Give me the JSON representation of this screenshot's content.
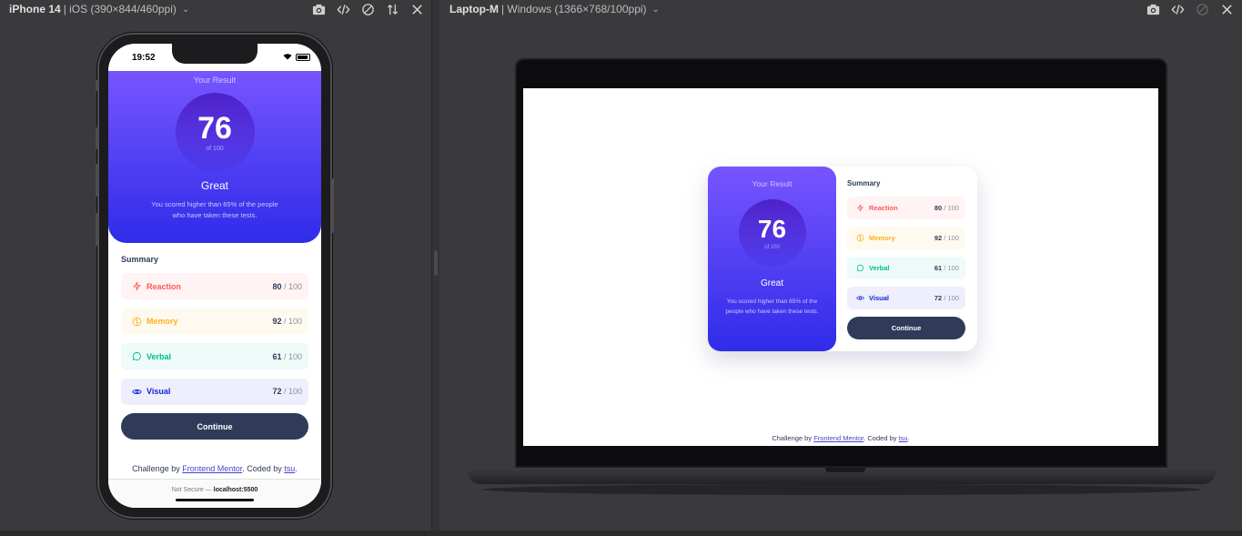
{
  "left_panel": {
    "device_name": "iPhone 14",
    "device_meta": "| iOS (390×844/460ppi)",
    "toolbar_icons": [
      "camera-icon",
      "code-icon",
      "rotate-icon",
      "swap-icon",
      "close-icon"
    ]
  },
  "right_panel": {
    "device_name": "Laptop-M",
    "device_meta": "| Windows (1366×768/100ppi)",
    "toolbar_icons": [
      "camera-icon",
      "code-icon",
      "rotate-icon",
      "close-icon"
    ]
  },
  "phone_status": {
    "time": "19:52"
  },
  "app": {
    "result_label": "Your Result",
    "score": "76",
    "score_of": "of 100",
    "verdict": "Great",
    "description": "You scored higher than 65% of the people who have taken these tests.",
    "summary_title": "Summary",
    "summary": [
      {
        "label": "Reaction",
        "score": "80",
        "total": "/ 100",
        "icon": "lightning-icon"
      },
      {
        "label": "Memory",
        "score": "92",
        "total": "/ 100",
        "icon": "brain-icon"
      },
      {
        "label": "Verbal",
        "score": "61",
        "total": "/ 100",
        "icon": "chat-icon"
      },
      {
        "label": "Visual",
        "score": "72",
        "total": "/ 100",
        "icon": "eye-icon"
      }
    ],
    "continue_label": "Continue",
    "footer": {
      "prefix": "Challenge by ",
      "link1": "Frontend Mentor",
      "middle": ". Coded by ",
      "link2": "tsu",
      "suffix": "."
    }
  },
  "phone_urlbar": {
    "prefix": "Not Secure — ",
    "host": "localhost:5500"
  },
  "colors": {
    "gradient_top": "#7755ff",
    "gradient_bottom": "#2f2ce9",
    "reaction": "#ff5757",
    "memory": "#ffb01f",
    "verbal": "#00bb8f",
    "visual": "#1125d6",
    "button": "#303b5a"
  }
}
